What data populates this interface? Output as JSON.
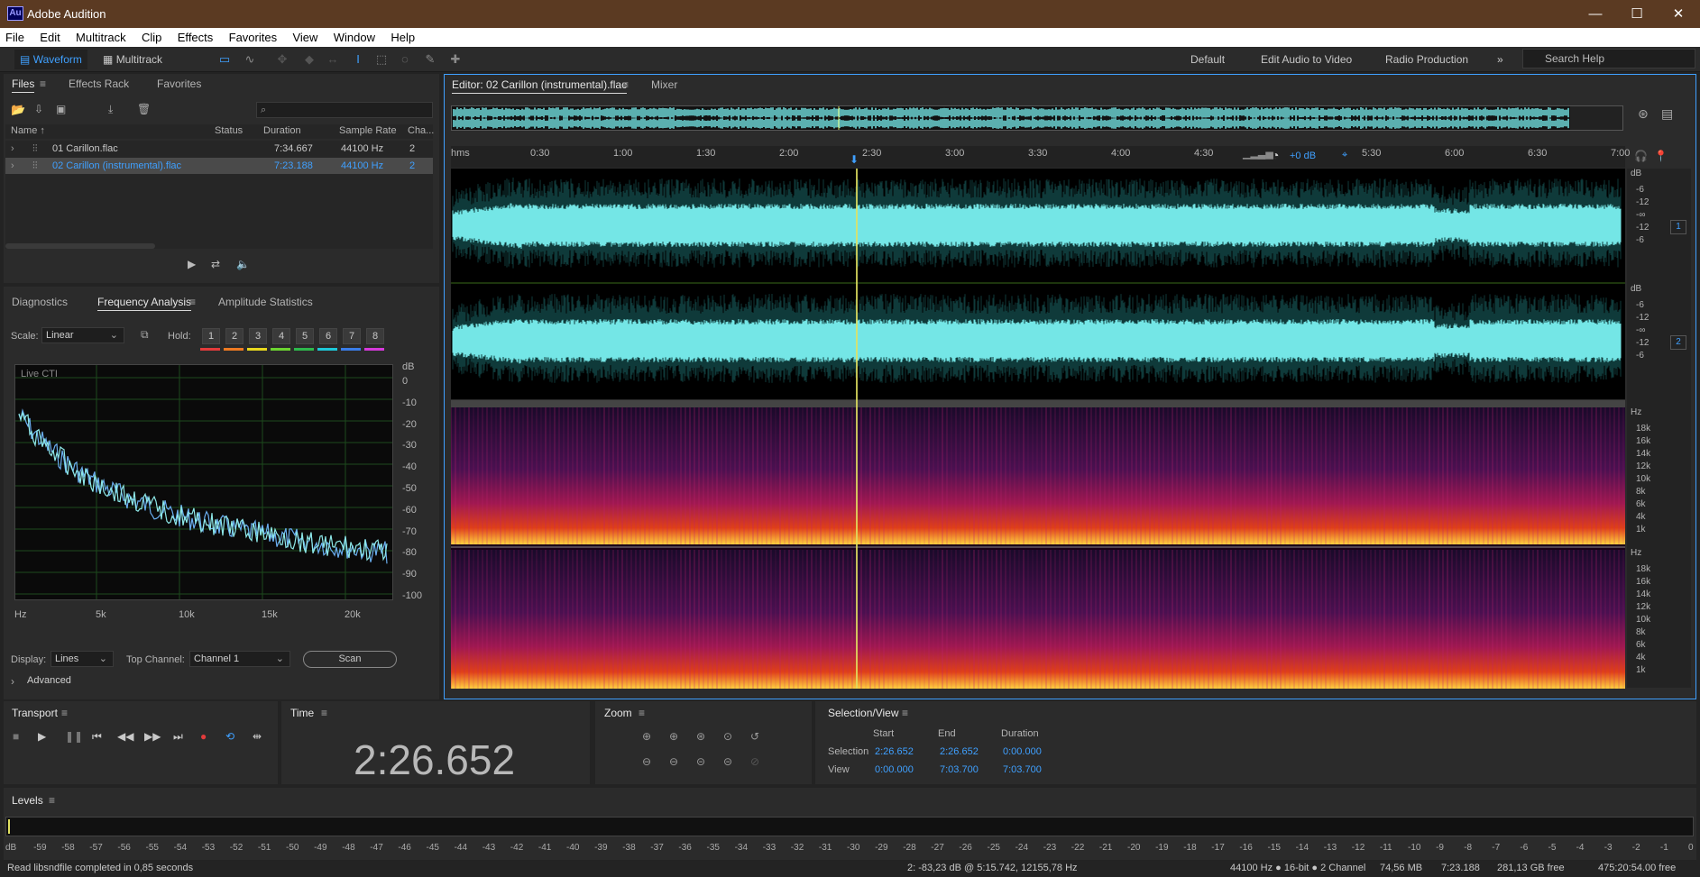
{
  "titlebar": {
    "app_icon": "Au",
    "title": "Adobe Audition",
    "minimize": "—",
    "maximize": "☐",
    "close": "✕"
  },
  "menu": [
    "File",
    "Edit",
    "Multitrack",
    "Clip",
    "Effects",
    "Favorites",
    "View",
    "Window",
    "Help"
  ],
  "toolbar": {
    "waveform": "Waveform",
    "multitrack": "Multitrack"
  },
  "workspaces": [
    "Default",
    "Edit Audio to Video",
    "Radio Production"
  ],
  "workspaces_more": "»",
  "search": {
    "placeholder": "Search Help"
  },
  "files_panel": {
    "tabs": [
      "Files",
      "Effects Rack",
      "Favorites"
    ],
    "columns": [
      "Name ↑",
      "Status",
      "Duration",
      "Sample Rate",
      "Cha..."
    ],
    "rows": [
      {
        "name": "01 Carillon.flac",
        "status": "",
        "duration": "7:34.667",
        "sample_rate": "44100 Hz",
        "channels": "2"
      },
      {
        "name": "02 Carillon (instrumental).flac",
        "status": "",
        "duration": "7:23.188",
        "sample_rate": "44100 Hz",
        "channels": "2"
      }
    ]
  },
  "diagnostics": {
    "tabs": [
      "Diagnostics",
      "Frequency Analysis",
      "Amplitude Statistics"
    ],
    "scale_label": "Scale:",
    "scale_value": "Linear",
    "hold_label": "Hold:",
    "hold": [
      "1",
      "2",
      "3",
      "4",
      "5",
      "6",
      "7",
      "8"
    ],
    "hold_colors": [
      "#e23b3b",
      "#ee7a22",
      "#e8d81e",
      "#6cd431",
      "#2eb84c",
      "#1ec8d8",
      "#3a7de8",
      "#d63adb"
    ],
    "live_cti": "Live CTI",
    "db_unit": "dB",
    "db_ticks": [
      "0",
      "-10",
      "-20",
      "-30",
      "-40",
      "-50",
      "-60",
      "-70",
      "-80",
      "-90",
      "-100"
    ],
    "hz_ticks": [
      "Hz",
      "5k",
      "10k",
      "15k",
      "20k"
    ],
    "display_label": "Display:",
    "display_value": "Lines",
    "top_channel_label": "Top Channel:",
    "top_channel_value": "Channel 1",
    "scan": "Scan",
    "advanced": "Advanced"
  },
  "editor": {
    "tab": "Editor: 02 Carillon (instrumental).flac",
    "mixer": "Mixer",
    "ruler": [
      "hms",
      "0:30",
      "1:00",
      "1:30",
      "2:00",
      "2:30",
      "3:00",
      "3:30",
      "4:00",
      "4:30",
      "5:30",
      "6:00",
      "6:30",
      "7:00"
    ],
    "gain": "+0 dB",
    "wave_scale": [
      "dB",
      "-6",
      "-12",
      "-∞",
      "-12",
      "-6"
    ],
    "channel_1": "1",
    "channel_2": "2",
    "spec_scale": [
      "Hz",
      "18k",
      "16k",
      "14k",
      "12k",
      "10k",
      "8k",
      "6k",
      "4k",
      "1k"
    ]
  },
  "transport": {
    "title": "Transport"
  },
  "time": {
    "title": "Time",
    "value": "2:26.652"
  },
  "zoom": {
    "title": "Zoom"
  },
  "selection": {
    "title": "Selection/View",
    "headers": [
      "Start",
      "End",
      "Duration"
    ],
    "selection_label": "Selection",
    "selection": [
      "2:26.652",
      "2:26.652",
      "0:00.000"
    ],
    "view_label": "View",
    "view": [
      "0:00.000",
      "7:03.700",
      "7:03.700"
    ]
  },
  "levels": {
    "title": "Levels",
    "scale": [
      "dB",
      "-59",
      "-58",
      "-57",
      "-56",
      "-55",
      "-54",
      "-53",
      "-52",
      "-51",
      "-50",
      "-49",
      "-48",
      "-47",
      "-46",
      "-45",
      "-44",
      "-43",
      "-42",
      "-41",
      "-40",
      "-39",
      "-38",
      "-37",
      "-36",
      "-35",
      "-34",
      "-33",
      "-32",
      "-31",
      "-30",
      "-29",
      "-28",
      "-27",
      "-26",
      "-25",
      "-24",
      "-23",
      "-22",
      "-21",
      "-20",
      "-19",
      "-18",
      "-17",
      "-16",
      "-15",
      "-14",
      "-13",
      "-12",
      "-11",
      "-10",
      "-9",
      "-8",
      "-7",
      "-6",
      "-5",
      "-4",
      "-3",
      "-2",
      "-1",
      "0"
    ]
  },
  "status": {
    "message": "Read libsndfile completed in 0,85 seconds",
    "cursor": "2: -83,23 dB @ 5:15.742, 12155,78 Hz",
    "format": "44100 Hz ● 16-bit ● 2 Channel",
    "size": "74,56 MB",
    "duration": "7:23.188",
    "free": "281,13 GB free",
    "time_free": "475:20:54.00 free"
  },
  "colors": {
    "accent": "#3fa0ff",
    "waveform": "#74e6e6",
    "titlebar": "#5b3a22",
    "playhead": "#e0e060"
  }
}
